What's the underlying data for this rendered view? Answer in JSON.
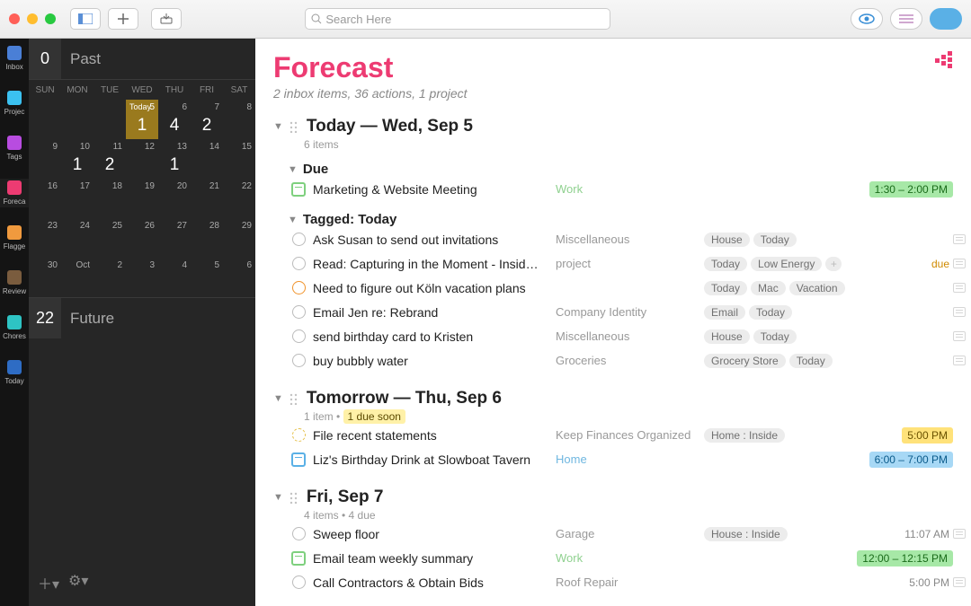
{
  "toolbar": {
    "search_placeholder": "Search Here"
  },
  "dock": {
    "items": [
      {
        "label": "Inbox",
        "color": "#4a7fd6"
      },
      {
        "label": "Projects",
        "color": "#3bc1f0"
      },
      {
        "label": "Tags",
        "color": "#b84ce0"
      },
      {
        "label": "Forecast",
        "color": "#ed3b72",
        "active": true
      },
      {
        "label": "Flagged",
        "color": "#f09a3e"
      },
      {
        "label": "Review",
        "color": "#7a5c3e"
      },
      {
        "label": "Chores",
        "color": "#2ec4c4"
      },
      {
        "label": "Today",
        "color": "#2e6cc4"
      }
    ]
  },
  "calendar": {
    "past": {
      "count": "0",
      "label": "Past"
    },
    "future": {
      "count": "22",
      "label": "Future"
    },
    "dow": [
      "SUN",
      "MON",
      "TUE",
      "WED",
      "THU",
      "FRI",
      "SAT"
    ],
    "weeks": [
      [
        {},
        {},
        {},
        {
          "d": "5",
          "big": "1",
          "today": true,
          "tlabel": "Today"
        },
        {
          "d": "6",
          "big": "4"
        },
        {
          "d": "7",
          "big": "2"
        },
        {
          "d": "8"
        }
      ],
      [
        {
          "d": "9"
        },
        {
          "d": "10",
          "big": "1"
        },
        {
          "d": "11",
          "big": "2"
        },
        {
          "d": "12"
        },
        {
          "d": "13",
          "big": "1"
        },
        {
          "d": "14"
        },
        {
          "d": "15"
        }
      ],
      [
        {
          "d": "16"
        },
        {
          "d": "17"
        },
        {
          "d": "18"
        },
        {
          "d": "19"
        },
        {
          "d": "20"
        },
        {
          "d": "21"
        },
        {
          "d": "22"
        }
      ],
      [
        {
          "d": "23"
        },
        {
          "d": "24"
        },
        {
          "d": "25"
        },
        {
          "d": "26"
        },
        {
          "d": "27"
        },
        {
          "d": "28"
        },
        {
          "d": "29"
        }
      ],
      [
        {
          "d": "30"
        },
        {
          "m": "Oct"
        },
        {
          "d": "2"
        },
        {
          "d": "3"
        },
        {
          "d": "4"
        },
        {
          "d": "5"
        },
        {
          "d": "6"
        }
      ]
    ]
  },
  "main": {
    "title": "Forecast",
    "subtitle": "2 inbox items, 36 actions, 1 project",
    "days": [
      {
        "title": "Today — Wed, Sep 5",
        "sub": "6 items",
        "groups": [
          {
            "title": "Due",
            "rows": [
              {
                "icon": "cal",
                "task": "Marketing & Website Meeting",
                "proj": "Work",
                "projCls": "work",
                "tags": [],
                "time": "1:30 – 2:00 PM",
                "timeCls": "green"
              }
            ]
          },
          {
            "title": "Tagged: Today",
            "rows": [
              {
                "icon": "circle",
                "task": "Ask Susan to send out invitations",
                "proj": "Miscellaneous",
                "tags": [
                  "House",
                  "Today"
                ],
                "note": true
              },
              {
                "icon": "circle",
                "task": "Read: Capturing in the Moment - Insid…",
                "proj": "project",
                "tags": [
                  "Today",
                  "Low Energy",
                  "+"
                ],
                "time": "due",
                "timeCls": "due",
                "note": true
              },
              {
                "icon": "circle-orange",
                "task": "Need to figure out Köln vacation plans",
                "proj": "",
                "tags": [
                  "Today",
                  "Mac",
                  "Vacation"
                ],
                "note": true
              },
              {
                "icon": "circle",
                "task": "Email Jen re: Rebrand",
                "proj": "Company Identity",
                "tags": [
                  "Email",
                  "Today"
                ],
                "note": true
              },
              {
                "icon": "circle",
                "task": "send birthday card to Kristen",
                "proj": "Miscellaneous",
                "tags": [
                  "House",
                  "Today"
                ],
                "note": true
              },
              {
                "icon": "circle",
                "task": "buy bubbly water",
                "proj": "Groceries",
                "tags": [
                  "Grocery Store",
                  "Today"
                ],
                "note": true
              }
            ]
          }
        ]
      },
      {
        "title": "Tomorrow — Thu, Sep 6",
        "sub": "1 item • ",
        "dueNote": "1 due soon",
        "groups": [
          {
            "rows": [
              {
                "icon": "circle-yellow",
                "task": "File recent statements",
                "proj": "Keep Finances Organized",
                "tags": [
                  "Home : Inside"
                ],
                "time": "5:00 PM",
                "timeCls": "yellow"
              },
              {
                "icon": "cal-blue",
                "task": "Liz's Birthday Drink at Slowboat Tavern",
                "proj": "Home",
                "projCls": "home",
                "tags": [],
                "time": "6:00 – 7:00 PM",
                "timeCls": "blue"
              }
            ]
          }
        ]
      },
      {
        "title": "Fri, Sep 7",
        "sub": "4 items • 4 due",
        "groups": [
          {
            "rows": [
              {
                "icon": "circle",
                "task": "Sweep floor",
                "proj": "Garage",
                "tags": [
                  "House : Inside"
                ],
                "time": "11:07 AM",
                "timeCls": "plain",
                "note": true
              },
              {
                "icon": "cal",
                "task": "Email team weekly summary",
                "proj": "Work",
                "projCls": "work",
                "tags": [],
                "time": "12:00 – 12:15 PM",
                "timeCls": "green"
              },
              {
                "icon": "circle",
                "task": "Call Contractors & Obtain Bids",
                "proj": "Roof Repair",
                "tags": [],
                "time": "5:00 PM",
                "timeCls": "plain",
                "note": true
              }
            ]
          }
        ]
      }
    ]
  }
}
